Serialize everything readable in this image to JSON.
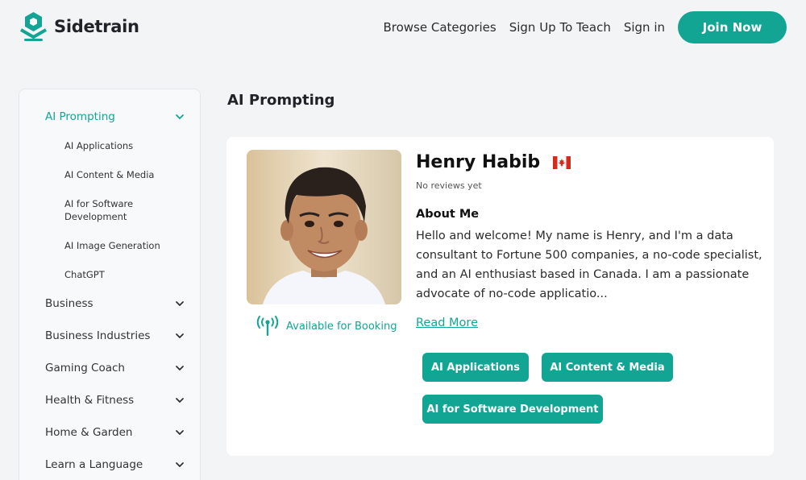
{
  "brand": {
    "name": "Sidetrain",
    "accent": "#12a594"
  },
  "nav": {
    "links": [
      "Browse Categories",
      "Sign Up To Teach",
      "Sign in"
    ],
    "cta": "Join Now"
  },
  "sidebar": {
    "categories": [
      {
        "label": "AI Prompting",
        "expanded": true,
        "children": [
          "AI Applications",
          "AI Content & Media",
          "AI for Software Development",
          "AI Image Generation",
          "ChatGPT"
        ]
      },
      {
        "label": "Business",
        "expanded": false
      },
      {
        "label": "Business Industries",
        "expanded": false
      },
      {
        "label": "Gaming Coach",
        "expanded": false
      },
      {
        "label": "Health & Fitness",
        "expanded": false
      },
      {
        "label": "Home & Garden",
        "expanded": false
      },
      {
        "label": "Learn a Language",
        "expanded": false
      }
    ]
  },
  "main": {
    "title": "AI Prompting",
    "coach": {
      "name": "Henry Habib",
      "flag_icon": "canada-flag-icon",
      "reviews": "No reviews yet",
      "availability": "Available for Booking",
      "about_heading": "About Me",
      "about_text": "Hello and welcome! My name is Henry, and I'm a data consultant to Fortune 500 companies, a no-code specialist, and an AI enthusiast based in Canada. I am a passionate advocate of no-code applicatio...",
      "read_more": "Read More",
      "tags": [
        "AI Applications",
        "AI Content & Media",
        "AI for Software Development"
      ]
    }
  }
}
